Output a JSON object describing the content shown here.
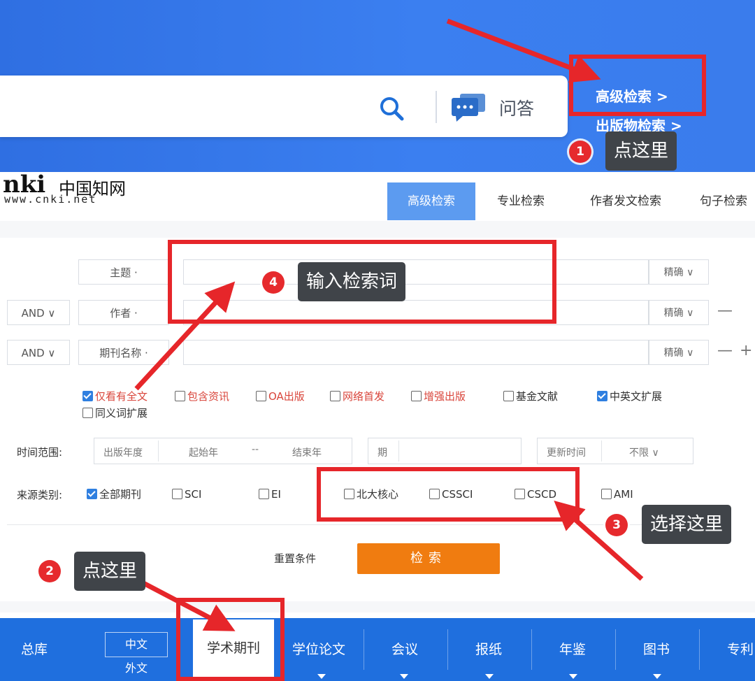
{
  "header": {
    "qa_label": "问答",
    "advanced_search_link": "高级检索 >",
    "publication_search_link": "出版物检索 >"
  },
  "logo": {
    "mark": "nki",
    "cn_name": "中国知网",
    "url": "www.cnki.net"
  },
  "search_mode_tabs": [
    {
      "label": "高级检索",
      "active": true
    },
    {
      "label": "专业检索",
      "active": false
    },
    {
      "label": "作者发文检索",
      "active": false
    },
    {
      "label": "句子检索",
      "active": false
    }
  ],
  "search_rows": [
    {
      "logic": "",
      "field": "主题 ·",
      "value": "",
      "match": "精确 ∨"
    },
    {
      "logic": "AND ∨",
      "field": "作者 ·",
      "value": "",
      "match": "精确 ∨"
    },
    {
      "logic": "AND ∨",
      "field": "期刊名称 ·",
      "value": "",
      "match": "精确 ∨"
    }
  ],
  "row_buttons": {
    "minus": "—",
    "plus": "+"
  },
  "filters": [
    {
      "label": "仅看有全文",
      "checked": true,
      "red": true
    },
    {
      "label": "包含资讯",
      "checked": false,
      "red": true
    },
    {
      "label": "OA出版",
      "checked": false,
      "red": true
    },
    {
      "label": "网络首发",
      "checked": false,
      "red": true
    },
    {
      "label": "增强出版",
      "checked": false,
      "red": true
    },
    {
      "label": "基金文献",
      "checked": false,
      "red": false
    },
    {
      "label": "中英文扩展",
      "checked": true,
      "red": false
    },
    {
      "label": "同义词扩展",
      "checked": false,
      "red": false
    }
  ],
  "time_range": {
    "label": "时间范围:",
    "pub_year": "出版年度",
    "start_year": "起始年",
    "dash": "--",
    "end_year": "结束年",
    "issue": "期",
    "update_label": "更新时间",
    "update_value": "不限 ∨"
  },
  "source": {
    "label": "来源类别:",
    "options": [
      {
        "label": "全部期刊",
        "checked": true
      },
      {
        "label": "SCI",
        "checked": false
      },
      {
        "label": "EI",
        "checked": false
      },
      {
        "label": "北大核心",
        "checked": false
      },
      {
        "label": "CSSCI",
        "checked": false
      },
      {
        "label": "CSCD",
        "checked": false
      },
      {
        "label": "AMI",
        "checked": false
      }
    ]
  },
  "actions": {
    "reset": "重置条件",
    "search": "检索"
  },
  "categories": {
    "total": "总库",
    "lang_cn": "中文",
    "lang_en": "外文",
    "items": [
      "学术期刊",
      "学位论文",
      "会议",
      "报纸",
      "年鉴",
      "图书",
      "专利"
    ]
  },
  "annotations": [
    {
      "num": "1",
      "text": "点这里"
    },
    {
      "num": "2",
      "text": "点这里"
    },
    {
      "num": "3",
      "text": "选择这里"
    },
    {
      "num": "4",
      "text": "输入检索词"
    }
  ],
  "colors": {
    "header_blue": "#3b7ff0",
    "bar_blue": "#1f6fde",
    "search_orange": "#f07c10",
    "annotation_red": "#e6262a",
    "checkbox_blue": "#2f7fe0"
  }
}
